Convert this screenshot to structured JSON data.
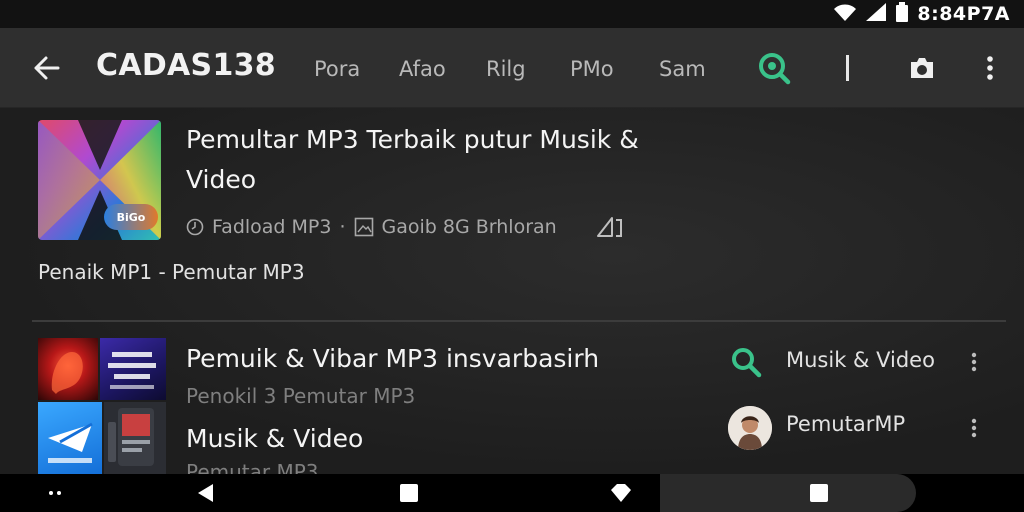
{
  "status_bar": {
    "time": "8:84P7A"
  },
  "app_bar": {
    "title": "CADAS138",
    "tabs": [
      "Pora",
      "Afao",
      "Rilg",
      "PMo",
      "Sam"
    ],
    "accent_color": "#3ac28a"
  },
  "items": [
    {
      "title": "Pemultar MP3 Terbaik putur Musik & Video",
      "meta_source": "Fadload MP3",
      "meta_separator": "·",
      "meta_author": "Gaoib 8G Brhloran",
      "description": "Penaik MP1 - Pemutar MP3",
      "thumbnail_badge": "BiGo"
    },
    {
      "title": "Pemuik & Vibar MP3 insvarbasirh",
      "subtitle": "Penokil 3 Pemutar MP3",
      "title_2": "Musik & Video",
      "subtitle_2": "Pemutar MP3"
    }
  ],
  "side_items": [
    {
      "label": "Musik & Video",
      "icon": "search-icon"
    },
    {
      "label": "PemutarMP",
      "icon": "avatar"
    }
  ]
}
